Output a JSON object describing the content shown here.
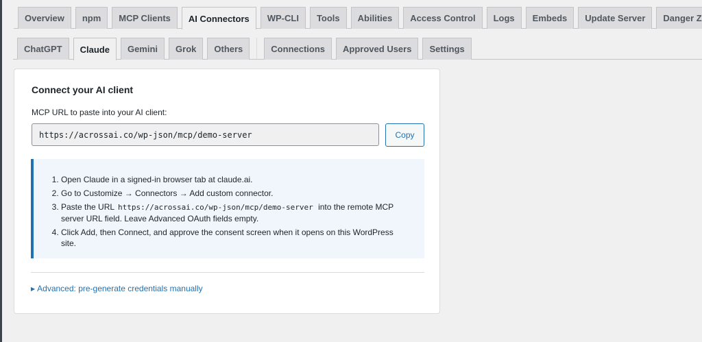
{
  "main_tabs": [
    {
      "label": "Overview",
      "active": false
    },
    {
      "label": "npm",
      "active": false
    },
    {
      "label": "MCP Clients",
      "active": false
    },
    {
      "label": "AI Connectors",
      "active": true
    },
    {
      "label": "WP-CLI",
      "active": false
    },
    {
      "label": "Tools",
      "active": false
    },
    {
      "label": "Abilities",
      "active": false
    },
    {
      "label": "Access Control",
      "active": false
    },
    {
      "label": "Logs",
      "active": false
    },
    {
      "label": "Embeds",
      "active": false
    },
    {
      "label": "Update Server",
      "active": false
    },
    {
      "label": "Danger Zone",
      "active": false
    }
  ],
  "client_tabs": [
    {
      "label": "ChatGPT",
      "active": false
    },
    {
      "label": "Claude",
      "active": true
    },
    {
      "label": "Gemini",
      "active": false
    },
    {
      "label": "Grok",
      "active": false
    },
    {
      "label": "Others",
      "active": false
    }
  ],
  "settings_tabs": [
    {
      "label": "Connections",
      "active": false
    },
    {
      "label": "Approved Users",
      "active": false
    },
    {
      "label": "Settings",
      "active": false
    }
  ],
  "card": {
    "title": "Connect your AI client",
    "url_label": "MCP URL to paste into your AI client:",
    "url_value": "https://acrossai.co/wp-json/mcp/demo-server",
    "copy_label": "Copy",
    "steps": {
      "s1": "Open Claude in a signed-in browser tab at claude.ai.",
      "s2": "Go to Customize → Connectors → Add custom connector.",
      "s3_pre": "Paste the URL",
      "s3_code": "https://acrossai.co/wp-json/mcp/demo-server",
      "s3_post": "into the remote MCP server URL field. Leave Advanced OAuth fields empty.",
      "s4": "Click Add, then Connect, and approve the consent screen when it opens on this WordPress site."
    },
    "advanced_label": "Advanced: pre-generate credentials manually"
  },
  "colors": {
    "accent": "#2271b1",
    "background": "#f0f0f1",
    "notice_bg": "#f0f6fc"
  }
}
